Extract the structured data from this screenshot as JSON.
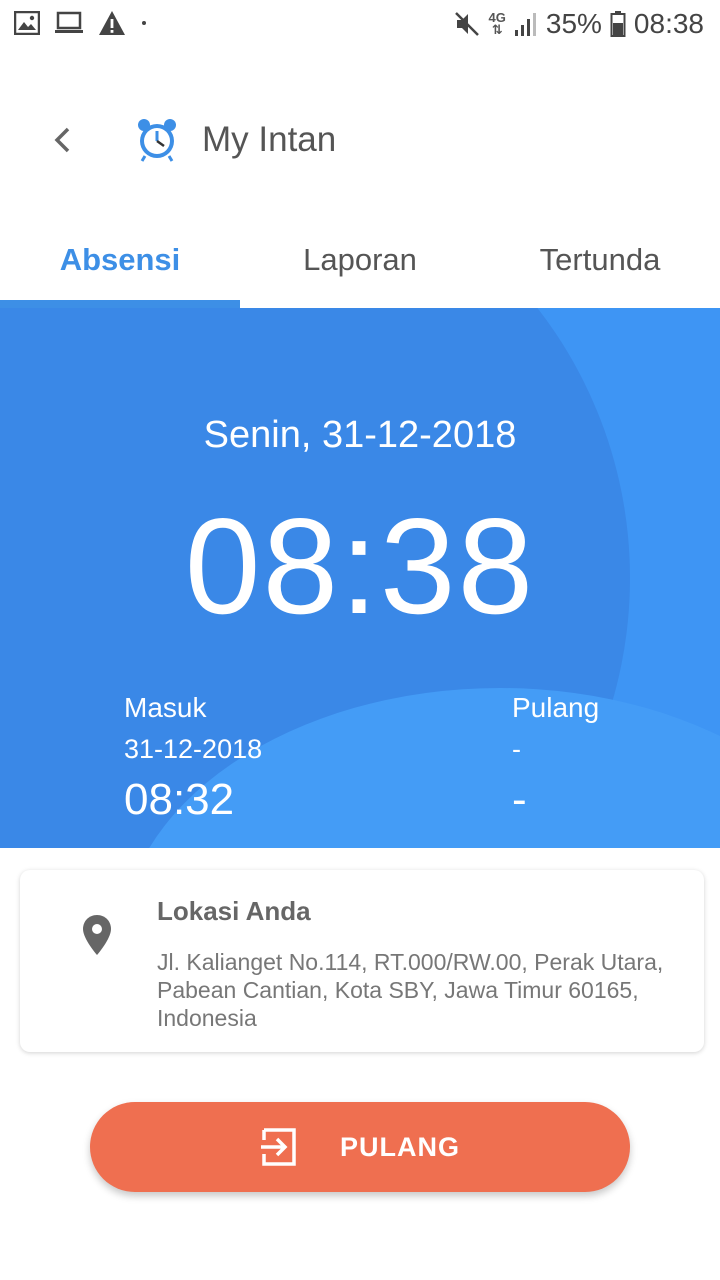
{
  "status_bar": {
    "battery": "35%",
    "time": "08:38",
    "network": "4G"
  },
  "app_bar": {
    "title": "My Intan"
  },
  "tabs": [
    {
      "label": "Absensi",
      "active": true
    },
    {
      "label": "Laporan",
      "active": false
    },
    {
      "label": "Tertunda",
      "active": false
    }
  ],
  "hero": {
    "date": "Senin, 31-12-2018",
    "time": "08:38",
    "masuk": {
      "label": "Masuk",
      "date": "31-12-2018",
      "time": "08:32"
    },
    "pulang": {
      "label": "Pulang",
      "date": "-",
      "time": "-"
    }
  },
  "location": {
    "title": "Lokasi Anda",
    "address": "Jl. Kalianget No.114, RT.000/RW.00, Perak Utara, Pabean Cantian, Kota SBY, Jawa Timur 60165, Indonesia"
  },
  "action": {
    "label": "PULANG"
  },
  "colors": {
    "accent": "#3d8fe6",
    "hero_bg": "#3e95f4",
    "action_bg": "#ef6f50"
  }
}
